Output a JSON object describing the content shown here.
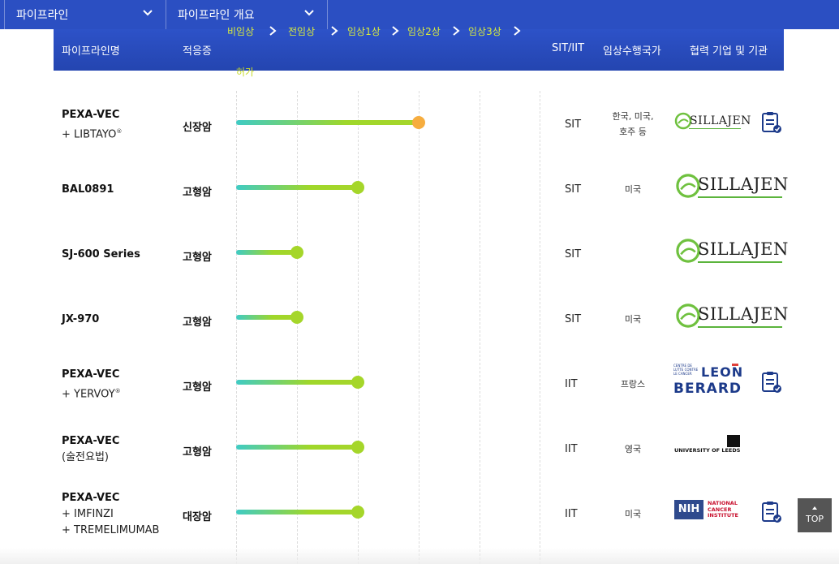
{
  "nav": {
    "dropdown1": "파이프라인",
    "dropdown2": "파이프라인 개요"
  },
  "table": {
    "headers": {
      "name": "파이프라인명",
      "indication": "적응증",
      "sit_iit": "SIT/IIT",
      "country": "임상수행국가",
      "partner": "협력 기업 및 기관"
    },
    "phases": [
      "비임상",
      "전임상",
      "임상1상",
      "임상2상",
      "임상3상"
    ],
    "phase_sub": "허가",
    "rows": [
      {
        "name": "PEXA-VEC",
        "sub": "+ LIBTAYO",
        "sup": "®",
        "indication": "신장암",
        "progress_phases": 3.0,
        "dot": "orange",
        "type": "SIT",
        "country_line1": "한국, 미국,",
        "country_line2": "호주 등",
        "partner": "SILLAJEN",
        "has_doc": true
      },
      {
        "name": "BAL0891",
        "sub": "",
        "sup": "",
        "indication": "고형암",
        "progress_phases": 2.0,
        "dot": "green",
        "type": "SIT",
        "country_line1": "미국",
        "country_line2": "",
        "partner": "SILLAJEN",
        "has_doc": false
      },
      {
        "name": "SJ-600 Series",
        "sub": "",
        "sup": "",
        "indication": "고형암",
        "progress_phases": 1.0,
        "dot": "green",
        "type": "SIT",
        "country_line1": "",
        "country_line2": "",
        "partner": "SILLAJEN",
        "has_doc": false
      },
      {
        "name": "JX-970",
        "sub": "",
        "sup": "",
        "indication": "고형암",
        "progress_phases": 1.0,
        "dot": "green",
        "type": "SIT",
        "country_line1": "미국",
        "country_line2": "",
        "partner": "SILLAJEN",
        "has_doc": false
      },
      {
        "name": "PEXA-VEC",
        "sub": "+ YERVOY",
        "sup": "®",
        "indication": "고형암",
        "progress_phases": 2.0,
        "dot": "green",
        "type": "IIT",
        "country_line1": "프랑스",
        "country_line2": "",
        "partner": "LEON BERARD",
        "has_doc": true
      },
      {
        "name": "PEXA-VEC",
        "sub": "(술전요법)",
        "sup": "",
        "indication": "고형암",
        "progress_phases": 2.0,
        "dot": "green",
        "type": "IIT",
        "country_line1": "영국",
        "country_line2": "",
        "partner": "UNIVERSITY OF LEEDS",
        "has_doc": false
      },
      {
        "name": "PEXA-VEC",
        "sub": "+ IMFINZI",
        "sub2": "+ TREMELIMUMAB",
        "sup": "",
        "indication": "대장암",
        "progress_phases": 2.0,
        "dot": "green",
        "type": "IIT",
        "country_line1": "미국",
        "country_line2": "",
        "partner": "NIH NATIONAL CANCER INSTITUTE",
        "has_doc": true
      }
    ]
  },
  "logos": {
    "sillajen": "SILLAJEN",
    "leon_small": "CENTRE DE LUTTE CONTRE LE CANCER",
    "leon": "LEON",
    "berard": "BERARD",
    "leeds": "UNIVERSITY OF LEEDS",
    "nih": "NIH",
    "nci1": "NATIONAL",
    "nci2": "CANCER",
    "nci3": "INSTITUTE"
  },
  "top_button": "TOP",
  "colors": {
    "nav": "#2b4fc2",
    "accent_green": "#a5d62a",
    "accent_orange": "#f6ad3f",
    "phase_text": "#d7ea3e"
  }
}
